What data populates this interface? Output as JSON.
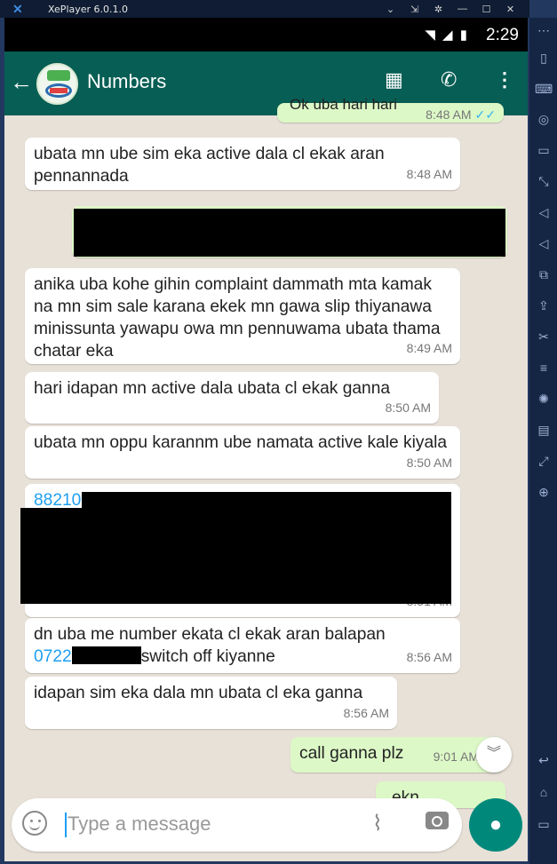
{
  "emulator": {
    "title": "XePlayer 6.0.1.0",
    "controls": [
      "⌄",
      "⇲",
      "✲",
      "—",
      "☐",
      "✕"
    ],
    "side_icons": [
      "⋯",
      "▯",
      "⌨",
      "◎",
      "▭",
      "⤡",
      "◁",
      "◁",
      "⧉",
      "⇪",
      "✂",
      "≡",
      "✺",
      "▤",
      "⤢",
      "⊕",
      "↩",
      "⌂",
      "▭"
    ]
  },
  "status_bar": {
    "time": "2:29",
    "icons": "◥ ◢ ▮"
  },
  "app_bar": {
    "contact_name": "Numbers",
    "icons": {
      "back": "arrow-back-icon",
      "store": "store-icon",
      "call": "add-call-icon",
      "menu": "more-vert-icon"
    }
  },
  "messages": [
    {
      "text": "Ok uba hari hari",
      "time": "8:48 AM",
      "direction": "out"
    },
    {
      "text": "ubata mn ube sim eka active dala cl ekak aran pennannada",
      "time": "8:48 AM",
      "direction": "in"
    },
    {
      "text": "",
      "time": "",
      "direction": "out",
      "redacted": true
    },
    {
      "text": "anika uba kohe gihin complaint dammath mta kamak na mn sim sale karana ekek mn gawa slip thiyanawa minissunta yawapu owa mn pennuwama ubata thama chatar eka",
      "time": "8:49 AM",
      "direction": "in"
    },
    {
      "text": "hari idapan mn active dala ubata cl ekak ganna",
      "time": "8:50 AM",
      "direction": "in"
    },
    {
      "text": "ubata mn oppu karannm ube namata active kale kiyala",
      "time": "8:50 AM",
      "direction": "in"
    },
    {
      "text_prefix": "88210",
      "time": "8:51 AM",
      "direction": "in",
      "redacted": true
    },
    {
      "text_line1": "dn uba me number ekata cl ekak aran balapan",
      "link_prefix": "0722",
      "suffix": "switch off kiyanne",
      "time": "8:56 AM",
      "direction": "in"
    },
    {
      "text": "idapan sim eka dala mn ubata cl eka ganna",
      "time": "8:56 AM",
      "direction": "in"
    },
    {
      "text": "call ganna plz",
      "time": "9:01 AM",
      "direction": "out"
    },
    {
      "text": "ekn",
      "time": "",
      "direction": "out"
    }
  ],
  "composer": {
    "placeholder": "Type a message"
  },
  "colors": {
    "header": "#075e54",
    "outgoing": "#dcf8c6",
    "incoming": "#ffffff",
    "mic": "#00897b",
    "link": "#1e9ff2"
  }
}
